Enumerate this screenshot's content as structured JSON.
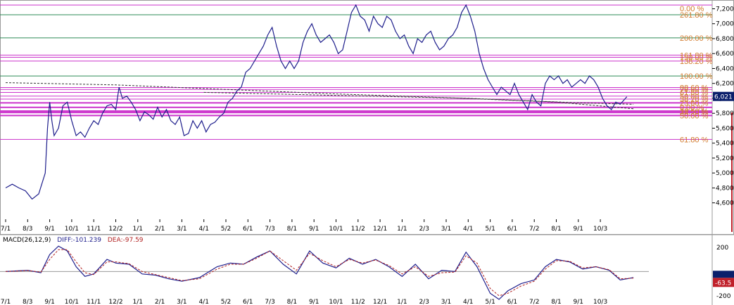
{
  "chart_data": {
    "type": "line",
    "colors": {
      "price": "#1e1e8c",
      "fib_line": "#cc33cc",
      "grid_line": "#2e8b57",
      "fib_label": "#d27a2c",
      "macd_diff": "#1e1e8c",
      "macd_dea": "#b22222",
      "current_price_box": "#0a1f6b",
      "current_macd_box": "#c0202a"
    },
    "x_tick_labels": [
      "7/1",
      "8/3",
      "9/1",
      "10/1",
      "11/1",
      "12/2",
      "1/1",
      "2/1",
      "3/1",
      "4/1",
      "5/2",
      "6/1",
      "7/3",
      "8/1",
      "9/1",
      "10/1",
      "11/2",
      "12/1",
      "1/1",
      "2/3",
      "3/1",
      "4/1",
      "5/1",
      "6/1",
      "7/2",
      "8/1",
      "9/1",
      "10/3"
    ],
    "y_ticks": [
      4600,
      4800,
      5000,
      5200,
      5400,
      5600,
      5800,
      6000,
      6200,
      6400,
      6600,
      6800,
      7000,
      7200
    ],
    "ylim": [
      4380,
      7280
    ],
    "current_price": "6,021",
    "fib_levels": [
      {
        "label": "0.00 %",
        "value": 7250
      },
      {
        "label": "261.80 %",
        "value": 7120
      },
      {
        "label": "200.00 %",
        "value": 6810
      },
      {
        "label": "161.80 %",
        "value": 6580
      },
      {
        "label": "150.00 %",
        "value": 6550
      },
      {
        "label": "138.20 %",
        "value": 6500
      },
      {
        "label": "100.00 %",
        "value": 6300
      },
      {
        "label": "88.60 %",
        "value": 6145
      },
      {
        "label": "78.60 %",
        "value": 6120
      },
      {
        "label": "61.80 %",
        "value": 6080
      },
      {
        "label": "50.00 %",
        "value": 6030
      },
      {
        "label": "38.20 %",
        "value": 5990
      },
      {
        "label": "23.60 %",
        "value": 5940
      },
      {
        "label": "0.00 %",
        "value": 5880
      },
      {
        "label": "23.60 %",
        "value": 5830
      },
      {
        "label": "38.20 %",
        "value": 5810
      },
      {
        "label": "50.00 %",
        "value": 5770
      },
      {
        "label": "61.80 %",
        "value": 5450
      }
    ],
    "price_series": [
      [
        0,
        4800
      ],
      [
        0.3,
        4850
      ],
      [
        0.6,
        4800
      ],
      [
        0.9,
        4760
      ],
      [
        1.2,
        4650
      ],
      [
        1.5,
        4720
      ],
      [
        1.8,
        5000
      ],
      [
        1.9,
        5600
      ],
      [
        2.0,
        5950
      ],
      [
        2.1,
        5700
      ],
      [
        2.2,
        5500
      ],
      [
        2.4,
        5600
      ],
      [
        2.6,
        5900
      ],
      [
        2.8,
        5950
      ],
      [
        3.0,
        5700
      ],
      [
        3.2,
        5500
      ],
      [
        3.4,
        5550
      ],
      [
        3.6,
        5480
      ],
      [
        3.8,
        5600
      ],
      [
        4.0,
        5700
      ],
      [
        4.2,
        5650
      ],
      [
        4.4,
        5800
      ],
      [
        4.6,
        5900
      ],
      [
        4.8,
        5920
      ],
      [
        5.0,
        5850
      ],
      [
        5.15,
        6150
      ],
      [
        5.3,
        6000
      ],
      [
        5.5,
        6030
      ],
      [
        5.7,
        5950
      ],
      [
        5.9,
        5850
      ],
      [
        6.1,
        5700
      ],
      [
        6.3,
        5820
      ],
      [
        6.5,
        5780
      ],
      [
        6.7,
        5720
      ],
      [
        6.9,
        5880
      ],
      [
        7.1,
        5750
      ],
      [
        7.3,
        5850
      ],
      [
        7.5,
        5700
      ],
      [
        7.7,
        5650
      ],
      [
        7.9,
        5750
      ],
      [
        8.1,
        5500
      ],
      [
        8.3,
        5530
      ],
      [
        8.5,
        5700
      ],
      [
        8.7,
        5600
      ],
      [
        8.9,
        5700
      ],
      [
        9.1,
        5550
      ],
      [
        9.3,
        5650
      ],
      [
        9.5,
        5680
      ],
      [
        9.7,
        5750
      ],
      [
        9.9,
        5800
      ],
      [
        10.1,
        5950
      ],
      [
        10.3,
        6000
      ],
      [
        10.5,
        6100
      ],
      [
        10.7,
        6150
      ],
      [
        10.9,
        6350
      ],
      [
        11.1,
        6400
      ],
      [
        11.3,
        6500
      ],
      [
        11.5,
        6600
      ],
      [
        11.7,
        6700
      ],
      [
        11.9,
        6850
      ],
      [
        12.1,
        6950
      ],
      [
        12.3,
        6700
      ],
      [
        12.5,
        6500
      ],
      [
        12.7,
        6400
      ],
      [
        12.9,
        6500
      ],
      [
        13.1,
        6400
      ],
      [
        13.3,
        6500
      ],
      [
        13.5,
        6750
      ],
      [
        13.7,
        6900
      ],
      [
        13.9,
        7000
      ],
      [
        14.1,
        6850
      ],
      [
        14.3,
        6750
      ],
      [
        14.5,
        6800
      ],
      [
        14.7,
        6850
      ],
      [
        14.9,
        6750
      ],
      [
        15.1,
        6600
      ],
      [
        15.3,
        6650
      ],
      [
        15.5,
        6900
      ],
      [
        15.7,
        7150
      ],
      [
        15.9,
        7250
      ],
      [
        16.1,
        7100
      ],
      [
        16.3,
        7050
      ],
      [
        16.5,
        6900
      ],
      [
        16.7,
        7100
      ],
      [
        16.9,
        7000
      ],
      [
        17.1,
        6950
      ],
      [
        17.3,
        7100
      ],
      [
        17.5,
        7050
      ],
      [
        17.7,
        6900
      ],
      [
        17.9,
        6800
      ],
      [
        18.1,
        6850
      ],
      [
        18.3,
        6700
      ],
      [
        18.5,
        6600
      ],
      [
        18.7,
        6800
      ],
      [
        18.9,
        6750
      ],
      [
        19.1,
        6850
      ],
      [
        19.3,
        6900
      ],
      [
        19.5,
        6750
      ],
      [
        19.7,
        6650
      ],
      [
        19.9,
        6700
      ],
      [
        20.1,
        6800
      ],
      [
        20.3,
        6850
      ],
      [
        20.5,
        6950
      ],
      [
        20.7,
        7150
      ],
      [
        20.9,
        7250
      ],
      [
        21.1,
        7100
      ],
      [
        21.3,
        6900
      ],
      [
        21.5,
        6600
      ],
      [
        21.7,
        6400
      ],
      [
        21.9,
        6250
      ],
      [
        22.1,
        6150
      ],
      [
        22.3,
        6050
      ],
      [
        22.5,
        6150
      ],
      [
        22.7,
        6100
      ],
      [
        22.9,
        6050
      ],
      [
        23.1,
        6200
      ],
      [
        23.3,
        6050
      ],
      [
        23.5,
        5950
      ],
      [
        23.7,
        5850
      ],
      [
        23.9,
        6050
      ],
      [
        24.1,
        5950
      ],
      [
        24.3,
        5900
      ],
      [
        24.5,
        6200
      ],
      [
        24.7,
        6300
      ],
      [
        24.9,
        6250
      ],
      [
        25.1,
        6300
      ],
      [
        25.3,
        6200
      ],
      [
        25.5,
        6250
      ],
      [
        25.7,
        6150
      ],
      [
        25.9,
        6200
      ],
      [
        26.1,
        6250
      ],
      [
        26.3,
        6200
      ],
      [
        26.5,
        6300
      ],
      [
        26.7,
        6250
      ],
      [
        26.9,
        6150
      ],
      [
        27.1,
        6000
      ],
      [
        27.3,
        5900
      ],
      [
        27.5,
        5850
      ],
      [
        27.7,
        5950
      ],
      [
        27.9,
        5920
      ],
      [
        28.2,
        6021
      ]
    ],
    "trend_lines": [
      {
        "points": [
          [
            0,
            6210
          ],
          [
            5,
            6180
          ],
          [
            10,
            6120
          ],
          [
            15,
            6060
          ],
          [
            20,
            6010
          ],
          [
            25,
            5950
          ],
          [
            28.5,
            5860
          ]
        ]
      },
      {
        "points": [
          [
            9,
            6080
          ],
          [
            15,
            6040
          ],
          [
            21,
            6000
          ],
          [
            26,
            5940
          ],
          [
            28.5,
            5920
          ]
        ]
      }
    ],
    "macd": {
      "label": "MACD(26,12,9)",
      "diff_label": "DIFF:-101.239",
      "dea_label": "DEA:-97.59",
      "y_ticks": [
        200,
        -200
      ],
      "ylim": [
        -230,
        240
      ],
      "current_value": "-63.5",
      "diff_series": [
        [
          0,
          0
        ],
        [
          1,
          10
        ],
        [
          1.6,
          -10
        ],
        [
          2,
          140
        ],
        [
          2.4,
          210
        ],
        [
          2.8,
          170
        ],
        [
          3.2,
          40
        ],
        [
          3.6,
          -40
        ],
        [
          4,
          -20
        ],
        [
          4.6,
          100
        ],
        [
          5,
          70
        ],
        [
          5.6,
          60
        ],
        [
          6.2,
          -20
        ],
        [
          6.8,
          -30
        ],
        [
          7.4,
          -60
        ],
        [
          8,
          -80
        ],
        [
          8.8,
          -50
        ],
        [
          9.6,
          40
        ],
        [
          10.2,
          70
        ],
        [
          10.8,
          60
        ],
        [
          11.4,
          120
        ],
        [
          12,
          170
        ],
        [
          12.6,
          60
        ],
        [
          13.2,
          -20
        ],
        [
          13.8,
          170
        ],
        [
          14.4,
          70
        ],
        [
          15,
          30
        ],
        [
          15.6,
          110
        ],
        [
          16.2,
          60
        ],
        [
          16.8,
          100
        ],
        [
          17.4,
          40
        ],
        [
          18,
          -40
        ],
        [
          18.6,
          60
        ],
        [
          19.2,
          -60
        ],
        [
          19.8,
          10
        ],
        [
          20.4,
          0
        ],
        [
          20.9,
          160
        ],
        [
          21.4,
          40
        ],
        [
          22,
          -180
        ],
        [
          22.4,
          -230
        ],
        [
          22.8,
          -160
        ],
        [
          23.4,
          -100
        ],
        [
          24,
          -70
        ],
        [
          24.5,
          40
        ],
        [
          25,
          100
        ],
        [
          25.6,
          80
        ],
        [
          26.2,
          20
        ],
        [
          26.8,
          40
        ],
        [
          27.4,
          10
        ],
        [
          27.9,
          -70
        ],
        [
          28.5,
          -50
        ]
      ],
      "dea_series": [
        [
          0,
          0
        ],
        [
          1,
          8
        ],
        [
          1.6,
          -5
        ],
        [
          2,
          100
        ],
        [
          2.4,
          180
        ],
        [
          2.8,
          180
        ],
        [
          3.2,
          80
        ],
        [
          3.6,
          -10
        ],
        [
          4,
          -25
        ],
        [
          4.6,
          80
        ],
        [
          5,
          80
        ],
        [
          5.6,
          65
        ],
        [
          6.2,
          0
        ],
        [
          6.8,
          -25
        ],
        [
          7.4,
          -50
        ],
        [
          8,
          -75
        ],
        [
          8.8,
          -60
        ],
        [
          9.6,
          20
        ],
        [
          10.2,
          60
        ],
        [
          10.8,
          60
        ],
        [
          11.4,
          110
        ],
        [
          12,
          170
        ],
        [
          12.6,
          90
        ],
        [
          13.2,
          10
        ],
        [
          13.8,
          150
        ],
        [
          14.4,
          90
        ],
        [
          15,
          40
        ],
        [
          15.6,
          100
        ],
        [
          16.2,
          70
        ],
        [
          16.8,
          95
        ],
        [
          17.4,
          50
        ],
        [
          18,
          -20
        ],
        [
          18.6,
          40
        ],
        [
          19.2,
          -40
        ],
        [
          19.8,
          -10
        ],
        [
          20.4,
          -5
        ],
        [
          20.9,
          130
        ],
        [
          21.4,
          70
        ],
        [
          22,
          -140
        ],
        [
          22.4,
          -200
        ],
        [
          22.8,
          -180
        ],
        [
          23.4,
          -120
        ],
        [
          24,
          -80
        ],
        [
          24.5,
          20
        ],
        [
          25,
          90
        ],
        [
          25.6,
          85
        ],
        [
          26.2,
          30
        ],
        [
          26.8,
          40
        ],
        [
          27.4,
          15
        ],
        [
          27.9,
          -60
        ],
        [
          28.5,
          -55
        ]
      ]
    }
  }
}
